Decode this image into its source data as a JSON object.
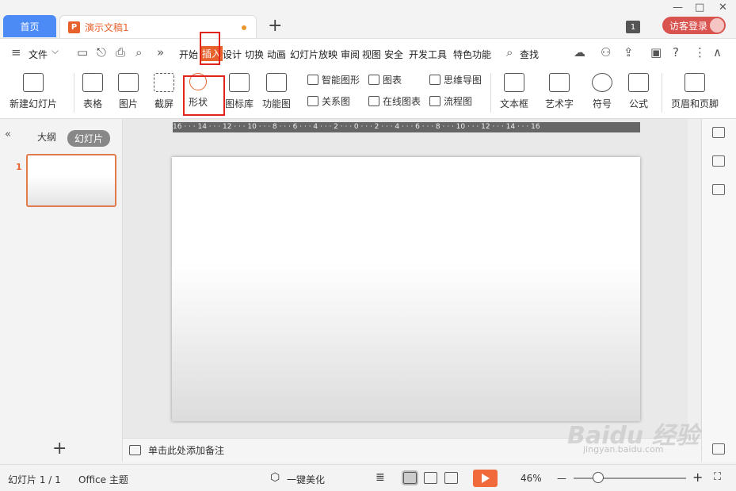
{
  "tabs": {
    "home_label": "首页",
    "doc_title": "演示文稿1",
    "doc_icon_letter": "P",
    "add_tab": "+"
  },
  "window": {
    "badge": "1",
    "guest_login": "访客登录",
    "minimize": "—",
    "maximize": "□",
    "close": "✕"
  },
  "menu": {
    "file_label": "文件",
    "items": [
      "开始",
      "插入",
      "设计",
      "切换",
      "动画",
      "幻灯片放映",
      "审阅",
      "视图",
      "安全",
      "开发工具",
      "特色功能"
    ],
    "active_index": 1,
    "search_label": "查找",
    "help": "?",
    "more": "⋮",
    "collapse": "∧"
  },
  "ribbon": {
    "new_slide": "新建幻灯片",
    "table": "表格",
    "image": "图片",
    "screenshot": "截屏",
    "shape": "形状",
    "icon_library": "图标库",
    "function_chart": "功能图",
    "smart_art": "智能图形",
    "chart": "图表",
    "relation_chart": "关系图",
    "online_chart": "在线图表",
    "mind_map": "思维导图",
    "flowchart": "流程图",
    "text_box": "文本框",
    "word_art": "艺术字",
    "symbol": "符号",
    "formula": "公式",
    "header_footer": "页眉和页脚"
  },
  "left_pane": {
    "outline_tab": "大纲",
    "slides_tab": "幻灯片",
    "slide_number": "1",
    "add_slide": "+"
  },
  "ruler": {
    "labels": "16 · · · 14 · · · 12 · · · 10 · · · 8 · · · 6 · · · 4 · · · 2 · · · 0 · · · 2 · · · 4 · · · 6 · · · 8 · · · 10 · · · 12 · · · 14 · · · 16"
  },
  "notes": {
    "placeholder": "单击此处添加备注"
  },
  "status": {
    "slide_count": "幻灯片 1 / 1",
    "theme": "Office 主题",
    "beautify": "一键美化",
    "zoom": "46%",
    "zoom_minus": "—",
    "zoom_plus": "+"
  },
  "watermark": {
    "brand": "Baidu 经验",
    "url": "jingyan.baidu.com"
  },
  "colors": {
    "accent": "#e8622d",
    "home_tab": "#4c8af5",
    "highlight_box": "#e0241c",
    "login_button": "#d9534f"
  }
}
